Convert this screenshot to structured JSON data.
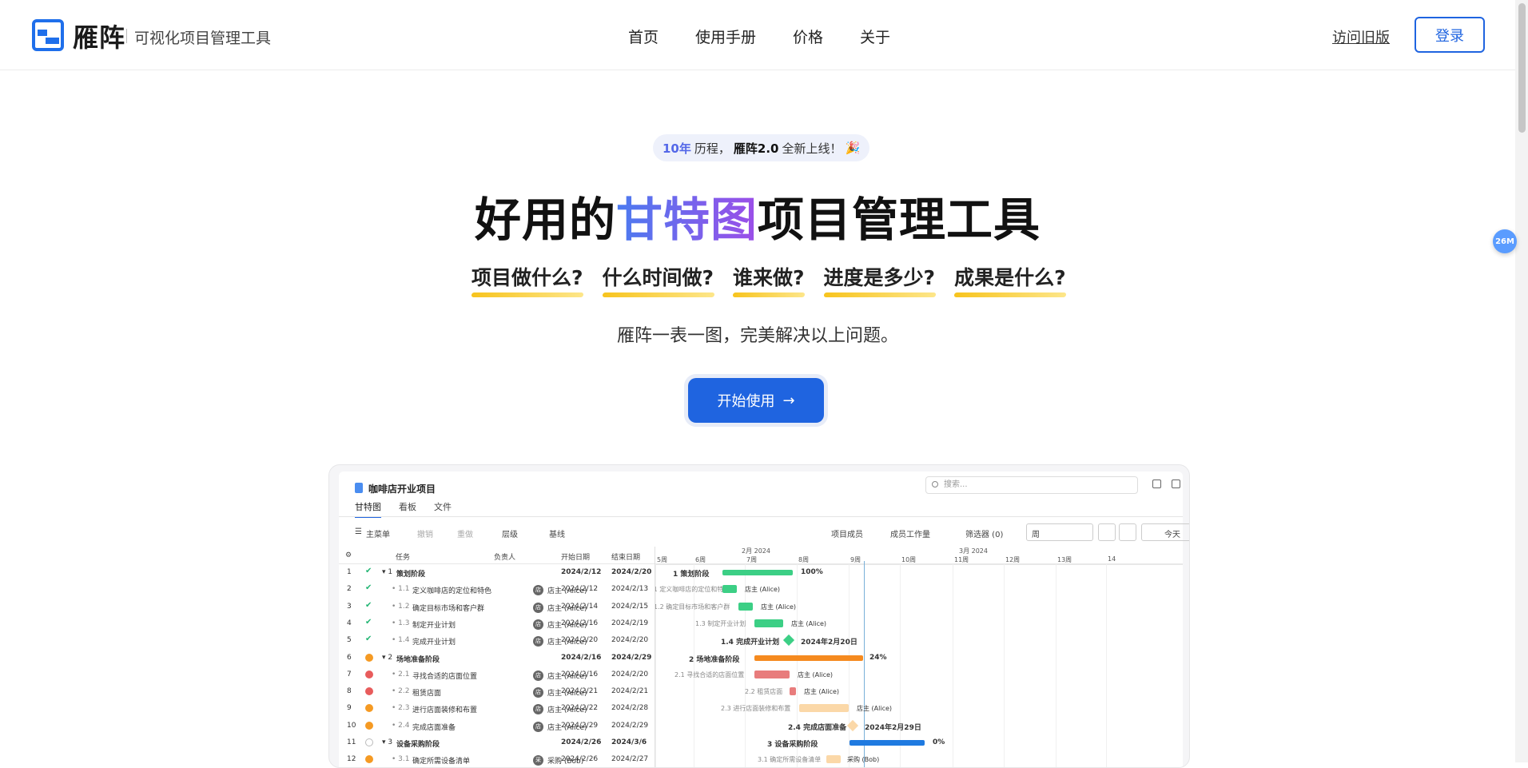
{
  "header": {
    "logo_name": "雁阵",
    "tagline": "可视化项目管理工具",
    "nav": [
      "首页",
      "使用手册",
      "价格",
      "关于"
    ],
    "old_version": "访问旧版",
    "login": "登录"
  },
  "float_badge": "26M",
  "hero": {
    "pill": {
      "years": "10年",
      "mid": "历程，",
      "version": "雁阵2.0",
      "tail": "全新上线！",
      "emoji": "🎉"
    },
    "title_pre": "好用的",
    "title_accent": "甘特图",
    "title_post": "项目管理工具",
    "questions": [
      "项目做什么?",
      "什么时间做?",
      "谁来做?",
      "进度是多少?",
      "成果是什么?"
    ],
    "subline": "雁阵一表一图，完美解决以上问题。",
    "cta": "开始使用",
    "cta_arrow": "→"
  },
  "preview": {
    "doc_title": "咖啡店开业项目",
    "search_placeholder": "搜索...",
    "tabs": [
      "甘特图",
      "看板",
      "文件"
    ],
    "toolbar": {
      "menu": "主菜单",
      "undo": "撤销",
      "redo": "重做",
      "level": "层级",
      "baseline": "基线",
      "members": "项目成员",
      "workspace": "成员工作量",
      "filter": "筛选器 (0)",
      "period": "周",
      "today": "今天"
    },
    "columns": {
      "task": "任务",
      "owner": "负责人",
      "start": "开始日期",
      "end": "结束日期"
    },
    "rows": [
      {
        "no": "1",
        "status": "ok",
        "wbs": "1",
        "name": "策划阶段",
        "owner": "",
        "start": "2024/2/12",
        "end": "2024/2/20",
        "summary": true
      },
      {
        "no": "2",
        "status": "ok",
        "wbs": "1.1",
        "name": "定义咖啡店的定位和特色",
        "owner": "店主 (Alice)",
        "start": "2024/2/12",
        "end": "2024/2/13"
      },
      {
        "no": "3",
        "status": "ok",
        "wbs": "1.2",
        "name": "确定目标市场和客户群",
        "owner": "店主 (Alice)",
        "start": "2024/2/14",
        "end": "2024/2/15"
      },
      {
        "no": "4",
        "status": "ok",
        "wbs": "1.3",
        "name": "制定开业计划",
        "owner": "店主 (Alice)",
        "start": "2024/2/16",
        "end": "2024/2/19"
      },
      {
        "no": "5",
        "status": "ok",
        "wbs": "1.4",
        "name": "完成开业计划",
        "owner": "店主 (Alice)",
        "start": "2024/2/20",
        "end": "2024/2/20"
      },
      {
        "no": "6",
        "status": "md",
        "wbs": "2",
        "name": "场地准备阶段",
        "owner": "",
        "start": "2024/2/16",
        "end": "2024/2/29",
        "summary": true
      },
      {
        "no": "7",
        "status": "hi",
        "wbs": "2.1",
        "name": "寻找合适的店面位置",
        "owner": "店主 (Alice)",
        "start": "2024/2/16",
        "end": "2024/2/20"
      },
      {
        "no": "8",
        "status": "hi",
        "wbs": "2.2",
        "name": "租赁店面",
        "owner": "店主 (Alice)",
        "start": "2024/2/21",
        "end": "2024/2/21"
      },
      {
        "no": "9",
        "status": "md",
        "wbs": "2.3",
        "name": "进行店面装修和布置",
        "owner": "店主 (Alice)",
        "start": "2024/2/22",
        "end": "2024/2/28"
      },
      {
        "no": "10",
        "status": "md",
        "wbs": "2.4",
        "name": "完成店面准备",
        "owner": "店主 (Alice)",
        "start": "2024/2/29",
        "end": "2024/2/29"
      },
      {
        "no": "11",
        "status": "no",
        "wbs": "3",
        "name": "设备采购阶段",
        "owner": "",
        "start": "2024/2/26",
        "end": "2024/3/6",
        "summary": true
      },
      {
        "no": "12",
        "status": "md",
        "wbs": "3.1",
        "name": "确定所需设备清单",
        "owner": "采购 (Bob)",
        "start": "2024/2/26",
        "end": "2024/2/27"
      }
    ],
    "gantt": {
      "months": [
        "2月 2024",
        "3月 2024"
      ],
      "weeks": [
        "5周",
        "6周",
        "7周",
        "8周",
        "9周",
        "10周",
        "11周",
        "12周",
        "13周",
        "14"
      ],
      "labels": {
        "r1": "1  策划阶段",
        "r1pct": "100%",
        "r2": "1.1 定义咖啡店的定位和特...",
        "r3": "1.2 确定目标市场和客户群",
        "r4": "1.3 制定开业计划",
        "r5": "1.4 完成开业计划",
        "r5date": "2024年2月20日",
        "r6": "2  场地准备阶段",
        "r6pct": "24%",
        "r7": "2.1 寻找合适的店面位置",
        "r8": "2.2 租赁店面",
        "r9": "2.3 进行店面装修和布置",
        "r10": "2.4 完成店面准备",
        "r10date": "2024年2月29日",
        "r11": "3  设备采购阶段",
        "r11pct": "0%",
        "r12": "3.1 确定所需设备清单",
        "owner_alice": "店主 (Alice)",
        "owner_bob": "采购 (Bob)"
      }
    }
  },
  "colors": {
    "brand": "#1f64e0",
    "accent_start": "#4b7bf0",
    "accent_end": "#9c4ee8",
    "underline": "#f7c41e",
    "done": "#3ccf85",
    "warn": "#f58a1f",
    "risk": "#e87c7c",
    "pending": "#fbd8a8",
    "blue": "#1f7ae0"
  }
}
